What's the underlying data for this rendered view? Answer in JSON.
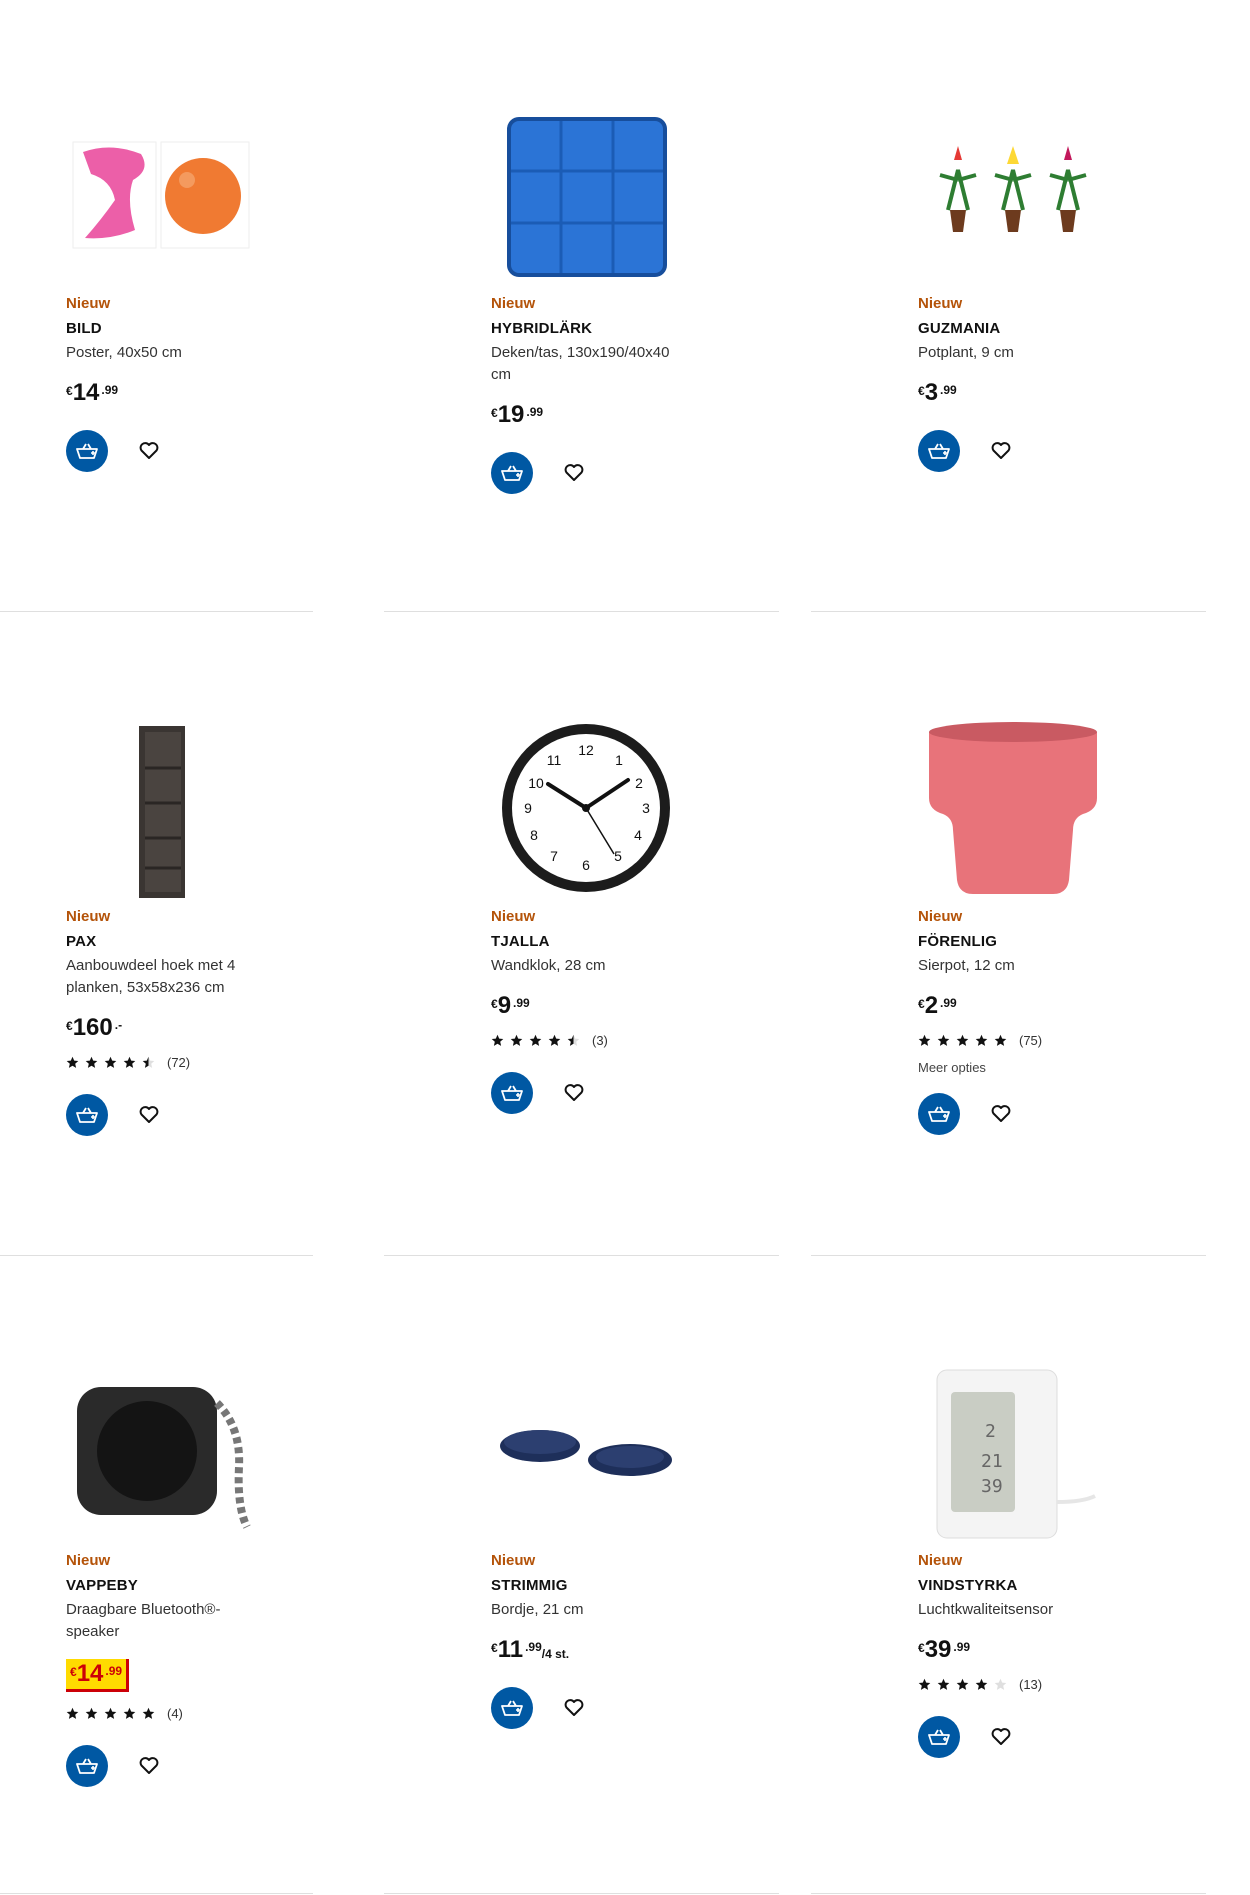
{
  "products": [
    {
      "badge": "Nieuw",
      "name": "BILD",
      "desc": "Poster, 40x50 cm",
      "price": {
        "currency": "€",
        "int": "14",
        "dec": ".99"
      }
    },
    {
      "badge": "Nieuw",
      "name": "HYBRIDLÄRK",
      "desc": "Deken/tas, 130x190/40x40 cm",
      "price": {
        "currency": "€",
        "int": "19",
        "dec": ".99"
      }
    },
    {
      "badge": "Nieuw",
      "name": "GUZMANIA",
      "desc": "Potplant, 9 cm",
      "price": {
        "currency": "€",
        "int": "3",
        "dec": ".99"
      }
    },
    {
      "badge": "Nieuw",
      "name": "PAX",
      "desc": "Aanbouwdeel hoek met 4 planken, 53x58x236 cm",
      "price": {
        "currency": "€",
        "int": "160",
        "dec": ".-"
      },
      "rating": {
        "stars": 4.5,
        "count": "(72)"
      }
    },
    {
      "badge": "Nieuw",
      "name": "TJALLA",
      "desc": "Wandklok, 28 cm",
      "price": {
        "currency": "€",
        "int": "9",
        "dec": ".99"
      },
      "rating": {
        "stars": 4.5,
        "count": "(3)"
      }
    },
    {
      "badge": "Nieuw",
      "name": "FÖRENLIG",
      "desc": "Sierpot, 12 cm",
      "price": {
        "currency": "€",
        "int": "2",
        "dec": ".99"
      },
      "rating": {
        "stars": 5,
        "count": "(75)"
      },
      "more": "Meer opties"
    },
    {
      "badge": "Nieuw",
      "name": "VAPPEBY",
      "desc": "Draagbare Bluetooth®-speaker",
      "price": {
        "currency": "€",
        "int": "14",
        "dec": ".99"
      },
      "rating": {
        "stars": 5,
        "count": "(4)"
      }
    },
    {
      "badge": "Nieuw",
      "name": "STRIMMIG",
      "desc": "Bordje, 21 cm",
      "price": {
        "currency": "€",
        "int": "11",
        "dec": ".99",
        "unit": "/4 st."
      }
    },
    {
      "badge": "Nieuw",
      "name": "VINDSTYRKA",
      "desc": "Luchtkwaliteitsensor",
      "price": {
        "currency": "€",
        "int": "39",
        "dec": ".99"
      },
      "rating": {
        "stars": 4,
        "count": "(13)"
      }
    }
  ],
  "icons": {
    "cart": "add-to-cart-icon",
    "favourite": "heart-icon",
    "star": "star-icon"
  },
  "colors": {
    "accent": "#0058a3",
    "new_badge": "#b45309",
    "highlight_bg": "#ffdb00",
    "highlight_fg": "#cc0008"
  }
}
